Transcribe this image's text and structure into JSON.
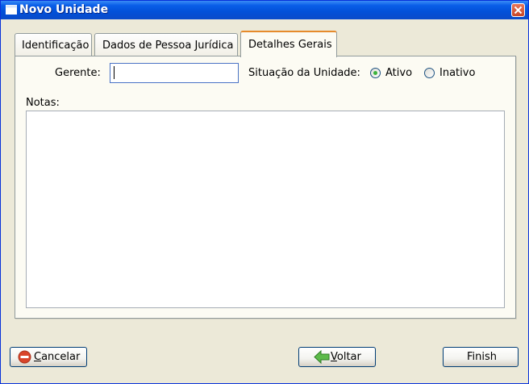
{
  "window": {
    "title": "Novo Unidade"
  },
  "tabs": [
    {
      "label": "Identificação",
      "active": false
    },
    {
      "label": "Dados de Pessoa Jurídica",
      "active": false
    },
    {
      "label": "Detalhes Gerais",
      "active": true
    }
  ],
  "form": {
    "gerente_label": "Gerente:",
    "gerente_value": "",
    "situacao_label": "Situação da Unidade:",
    "options": [
      {
        "label": "Ativo",
        "selected": true
      },
      {
        "label": "Inativo",
        "selected": false
      }
    ],
    "notas_label": "Notas:",
    "notas_value": ""
  },
  "buttons": {
    "cancel_first": "C",
    "cancel_rest": "ancelar",
    "back_first": "V",
    "back_rest": "oltar",
    "finish": "Finish"
  },
  "colors": {
    "titlebar": "#0a5ee8",
    "tab_highlight": "#e68b2c",
    "radio_dot": "#3cb33c",
    "cancel_icon": "#d9452b",
    "back_arrow": "#3ca63c"
  },
  "icons": {
    "window": "window-icon",
    "close": "close-icon",
    "cancel": "no-entry-icon",
    "back": "left-arrow-icon"
  }
}
